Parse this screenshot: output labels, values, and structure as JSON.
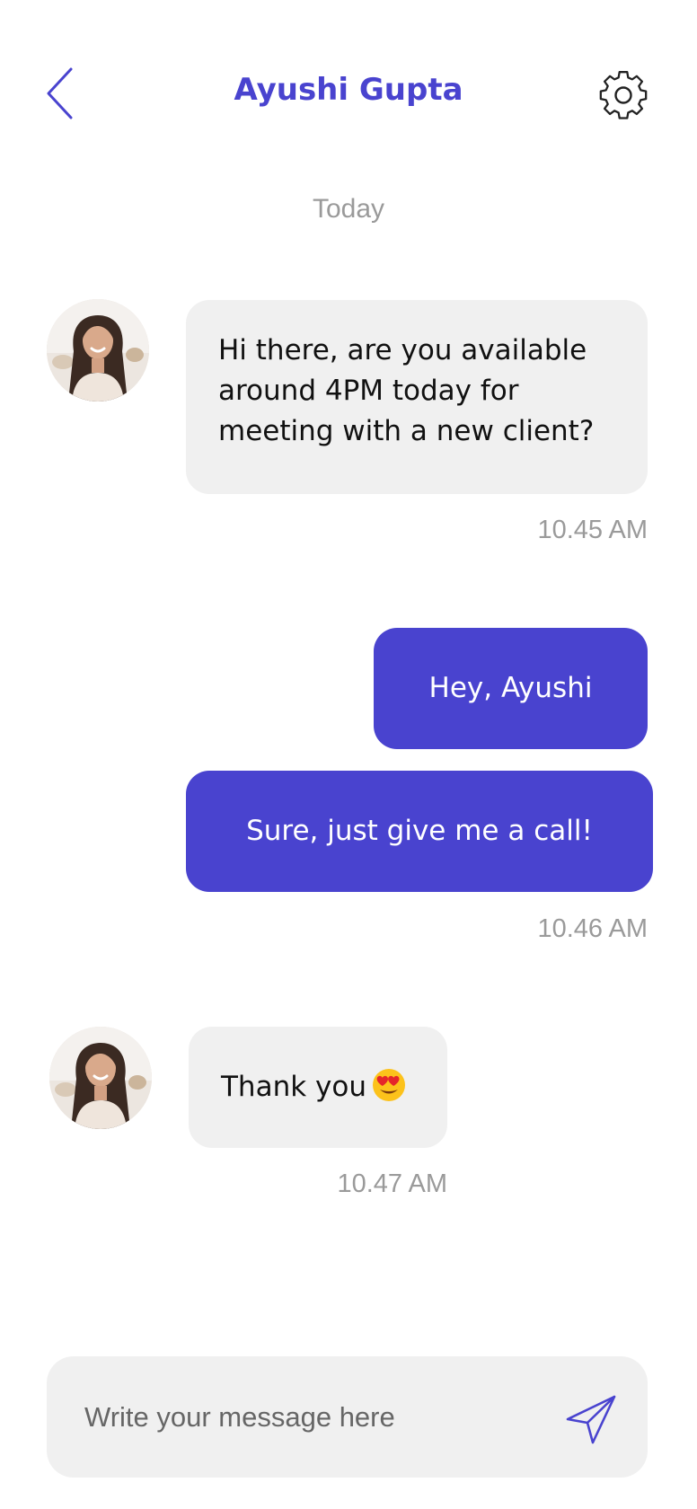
{
  "header": {
    "title": "Ayushi Gupta",
    "back_icon": "chevron-left-icon",
    "settings_icon": "gear-icon"
  },
  "date_separator": "Today",
  "messages": [
    {
      "direction": "incoming",
      "lines": [
        "Hi there, are you available",
        "around 4PM today for",
        "meeting with a new client?"
      ],
      "time": "10.45 AM"
    },
    {
      "direction": "outgoing",
      "text": "Hey, Ayushi"
    },
    {
      "direction": "outgoing",
      "text": "Sure, just give me a call!",
      "time": "10.46 AM"
    },
    {
      "direction": "incoming",
      "text": "Thank you",
      "emoji": "heart-eyes-emoji",
      "time": "10.47 AM"
    }
  ],
  "composer": {
    "placeholder": "Write your message here",
    "send_icon": "send-icon"
  },
  "colors": {
    "accent": "#4943cf",
    "incoming_bubble": "#f0f0f0",
    "timestamp": "#9a9a9a"
  }
}
